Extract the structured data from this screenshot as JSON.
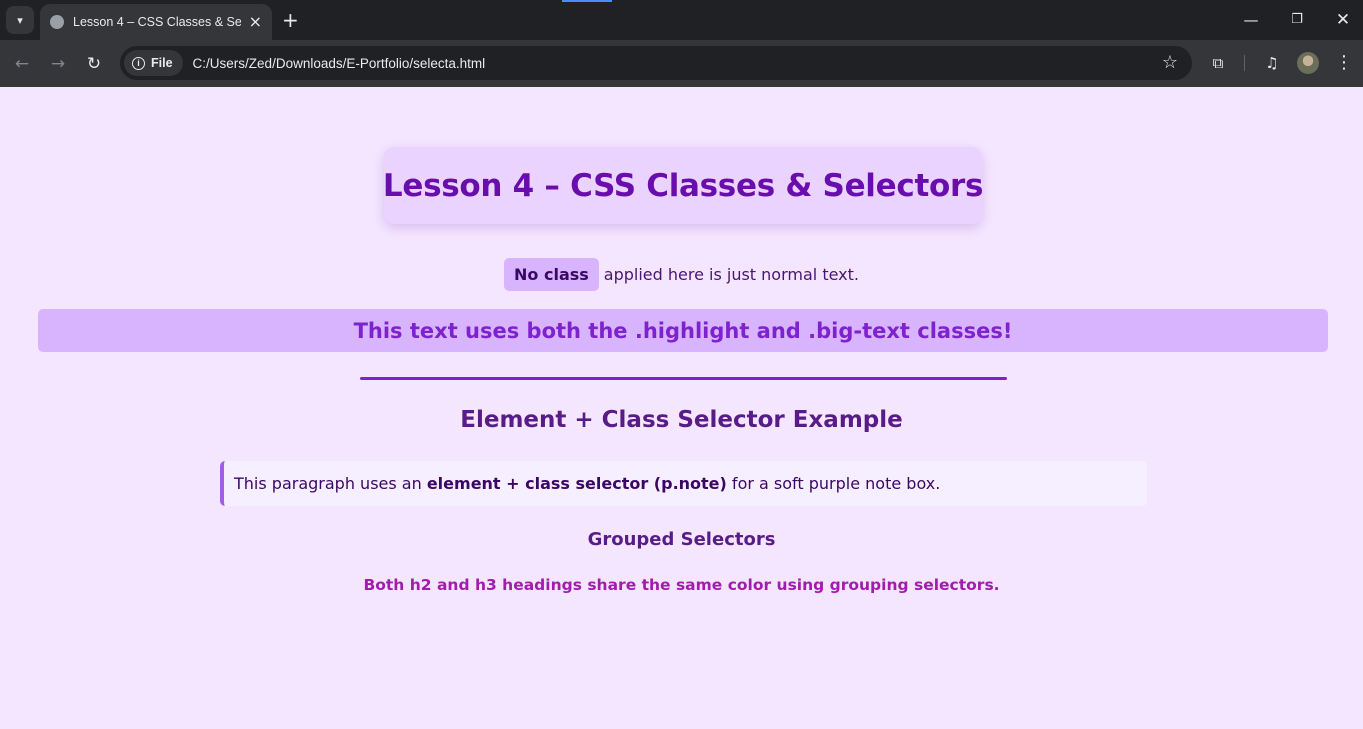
{
  "browser": {
    "tab_title": "Lesson 4 – CSS Classes & Selectors",
    "site_chip": "File",
    "url": "C:/Users/Zed/Downloads/E-Portfolio/selecta.html",
    "icons": [
      "tab-search-icon",
      "globe-icon",
      "close-icon",
      "plus-icon",
      "minimize-icon",
      "restore-icon",
      "window-close-icon",
      "back-icon",
      "forward-icon",
      "reload-icon",
      "info-icon",
      "star-icon",
      "extensions-icon",
      "media-icon",
      "avatar",
      "menu-icon"
    ]
  },
  "page": {
    "title": "Lesson 4 – CSS Classes & Selectors",
    "no_class_label": "No class",
    "no_class_rest": "applied here is just normal text.",
    "highlight_text": "This text uses both the .highlight and .big-text classes!",
    "section_heading": "Element + Class Selector Example",
    "note_before": "This paragraph uses an ",
    "note_bold": "element + class selector (p.note)",
    "note_after": " for a soft purple note box.",
    "grouped_heading": "Grouped Selectors",
    "grouped_text": "Both h2 and h3 headings share the same color using grouping selectors."
  },
  "colors": {
    "page_background": "#f5e6ff",
    "title_color": "#6a0dad",
    "highlight_background": "#d8b4fe",
    "highlight_text": "#7e22ce",
    "heading_color": "#581c87",
    "grouped_text_color": "#a21caf"
  }
}
